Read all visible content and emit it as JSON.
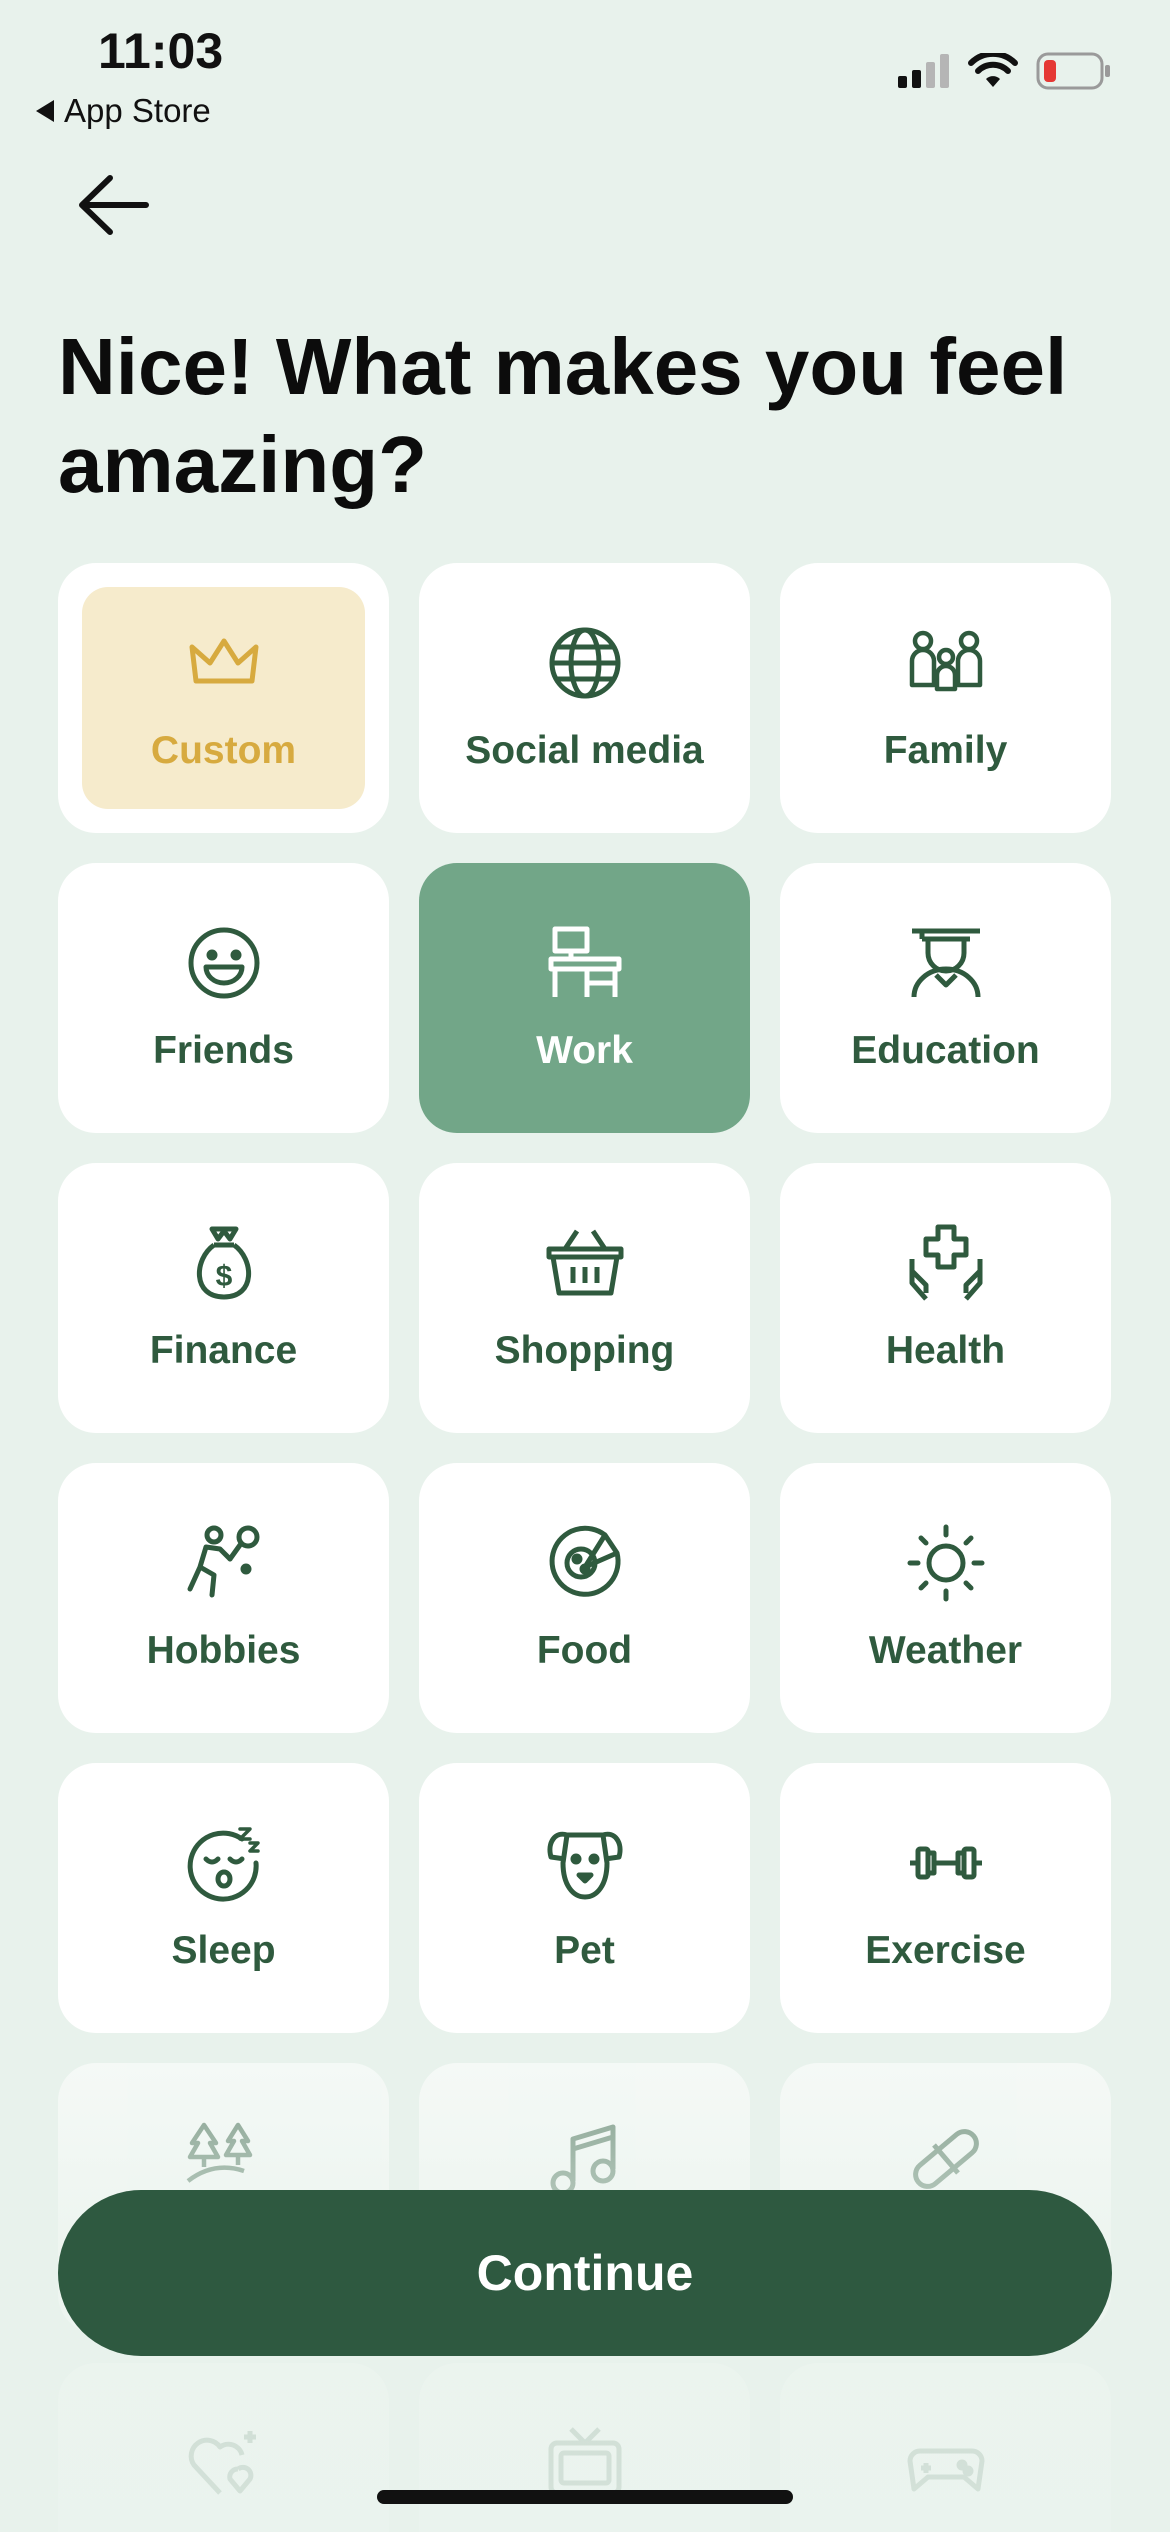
{
  "status_bar": {
    "time": "11:03",
    "back_app_label": "App Store"
  },
  "header": {
    "title": "Nice! What makes you feel amazing?"
  },
  "colors": {
    "background": "#e8f2ec",
    "tile": "#ffffff",
    "tile_label": "#2f5a3e",
    "selected_tile": "#72a688",
    "custom_tile": "#f6ebcc",
    "custom_label": "#d7aa3f",
    "button": "#2e5940"
  },
  "categories": [
    {
      "label": "Custom",
      "icon": "crown-icon",
      "state": "custom"
    },
    {
      "label": "Social media",
      "icon": "globe-icon",
      "state": "default"
    },
    {
      "label": "Family",
      "icon": "family-icon",
      "state": "default"
    },
    {
      "label": "Friends",
      "icon": "smiley-icon",
      "state": "default"
    },
    {
      "label": "Work",
      "icon": "desk-icon",
      "state": "selected"
    },
    {
      "label": "Education",
      "icon": "graduate-icon",
      "state": "default"
    },
    {
      "label": "Finance",
      "icon": "money-bag-icon",
      "state": "default"
    },
    {
      "label": "Shopping",
      "icon": "basket-icon",
      "state": "default"
    },
    {
      "label": "Health",
      "icon": "health-hands-icon",
      "state": "default"
    },
    {
      "label": "Hobbies",
      "icon": "tennis-player-icon",
      "state": "default"
    },
    {
      "label": "Food",
      "icon": "pizza-icon",
      "state": "default"
    },
    {
      "label": "Weather",
      "icon": "sun-icon",
      "state": "default"
    },
    {
      "label": "Sleep",
      "icon": "sleepy-face-icon",
      "state": "default"
    },
    {
      "label": "Pet",
      "icon": "dog-icon",
      "state": "default"
    },
    {
      "label": "Exercise",
      "icon": "dumbbell-icon",
      "state": "default"
    },
    {
      "label": "",
      "icon": "trees-icon",
      "state": "partial"
    },
    {
      "label": "",
      "icon": "music-note-icon",
      "state": "partial"
    },
    {
      "label": "",
      "icon": "pill-icon",
      "state": "partial"
    },
    {
      "label": "",
      "icon": "heart-sparkle-icon",
      "state": "partial"
    },
    {
      "label": "",
      "icon": "tv-icon",
      "state": "partial"
    },
    {
      "label": "",
      "icon": "gamepad-icon",
      "state": "partial"
    }
  ],
  "footer": {
    "continue_label": "Continue"
  }
}
